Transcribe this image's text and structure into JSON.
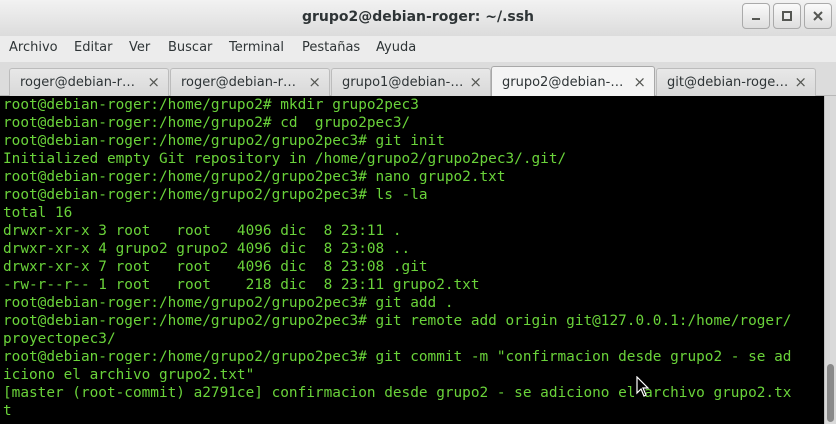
{
  "window": {
    "title": "grupo2@debian-roger: ~/.ssh"
  },
  "menu": [
    "Archivo",
    "Editar",
    "Ver",
    "Buscar",
    "Terminal",
    "Pestañas",
    "Ayuda"
  ],
  "tabs": [
    {
      "label": "roger@debian-r…",
      "active": false
    },
    {
      "label": "roger@debian-r…",
      "active": false
    },
    {
      "label": "grupo1@debian-…",
      "active": false
    },
    {
      "label": "grupo2@debian-…",
      "active": true
    },
    {
      "label": "git@debian-roge…",
      "active": false
    }
  ],
  "tab_close_symbol": "×",
  "terminal": {
    "lines": [
      "root@debian-roger:/home/grupo2# mkdir grupo2pec3",
      "root@debian-roger:/home/grupo2# cd  grupo2pec3/",
      "root@debian-roger:/home/grupo2/grupo2pec3# git init",
      "Initialized empty Git repository in /home/grupo2/grupo2pec3/.git/",
      "root@debian-roger:/home/grupo2/grupo2pec3# nano grupo2.txt",
      "root@debian-roger:/home/grupo2/grupo2pec3# ls -la",
      "total 16",
      "drwxr-xr-x 3 root   root   4096 dic  8 23:11 .",
      "drwxr-xr-x 4 grupo2 grupo2 4096 dic  8 23:08 ..",
      "drwxr-xr-x 7 root   root   4096 dic  8 23:08 .git",
      "-rw-r--r-- 1 root   root    218 dic  8 23:11 grupo2.txt",
      "root@debian-roger:/home/grupo2/grupo2pec3# git add .",
      "root@debian-roger:/home/grupo2/grupo2pec3# git remote add origin git@127.0.0.1:/home/roger/",
      "proyectopec3/",
      "root@debian-roger:/home/grupo2/grupo2pec3# git commit -m \"confirmacion desde grupo2 - se ad",
      "iciono el archivo grupo2.txt\"",
      "[master (root-commit) a2791ce] confirmacion desde grupo2 - se adiciono el archivo grupo2.tx",
      "t"
    ]
  },
  "colors": {
    "terminal_bg": "#000000",
    "terminal_fg": "#6ad33a"
  },
  "icons": {
    "minimize": "minimize-icon",
    "maximize": "maximize-icon",
    "close": "close-icon"
  }
}
